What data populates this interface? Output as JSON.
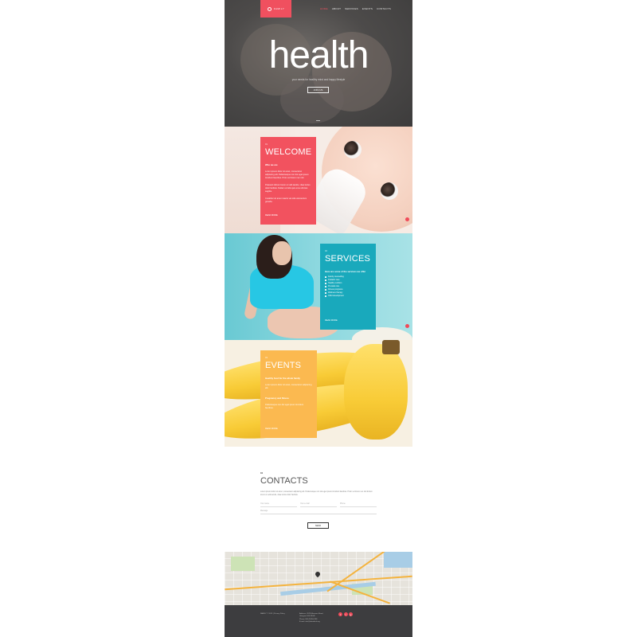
{
  "header": {
    "logo_text": "FAMILY",
    "nav": [
      "HOME",
      "ABOUT",
      "SERVICES",
      "EVENTS",
      "CONTACTS"
    ]
  },
  "hero": {
    "title": "health",
    "subtitle": "your needs for healthy mind and happy lifestyle",
    "button": "JOIN US"
  },
  "welcome": {
    "num": "01",
    "title": "WELCOME",
    "small_title": "Who we are",
    "paragraphs": [
      "Lorem ipsum dolor sit amet, consectetur adipiscing elit. Pellentesque non dui eget ipsum tincidunt faucibus. Proin vel lorem nec nisl.",
      "Praesent dictum lorem ut velit iaculis, vitae luctus dolor facilisis. Nullam ut felis quis eros ultricies sagittis.",
      "Curabitur sit amet mauris vel odio elementum gravida."
    ],
    "link": "READ MORE"
  },
  "services": {
    "num": "02",
    "title": "SERVICES",
    "intro": "Here are some of the services we offer",
    "items": [
      "Family counselling",
      "Pediatric care",
      "Healthy nutrition",
      "Prenatal care",
      "Fitness programs",
      "Wellness therapy",
      "Child development"
    ],
    "link": "READ MORE"
  },
  "events": {
    "num": "03",
    "title": "EVENTS",
    "event1_title": "Healthy food for the whole family",
    "event1_text": "Lorem ipsum dolor sit amet, consectetur adipiscing elit.",
    "event2_title": "Pregnancy and fitness",
    "event2_text": "Pellentesque non dui eget ipsum tincidunt faucibus.",
    "link": "READ MORE"
  },
  "contacts": {
    "num": "04",
    "title": "CONTACTS",
    "text": "Lorem ipsum dolor sit amet, consectetur adipiscing elit. Pellentesque non dui eget ipsum tincidunt faucibus. Proin vel lorem nec nisl dictum lorem ut velit iaculis, vitae luctus dolor facilisis.",
    "name_placeholder": "Your name",
    "email_placeholder": "Your e-mail",
    "phone_placeholder": "Phone",
    "message_placeholder": "Message",
    "send_button": "SEND"
  },
  "footer": {
    "copyright": "FAMILY © 2015 | Privacy Policy",
    "contact_lines": [
      "Address: 4578 Marmora Road,",
      "Glasgow D04 89GR",
      "Phone: 800-2345-6789",
      "E-mail: info@demolink.org"
    ],
    "social": [
      "f",
      "t",
      "g"
    ]
  },
  "colors": {
    "accent": "#f0505f",
    "services": "#19a9bc",
    "events": "#fbb950",
    "footer": "#3d3d3f"
  }
}
